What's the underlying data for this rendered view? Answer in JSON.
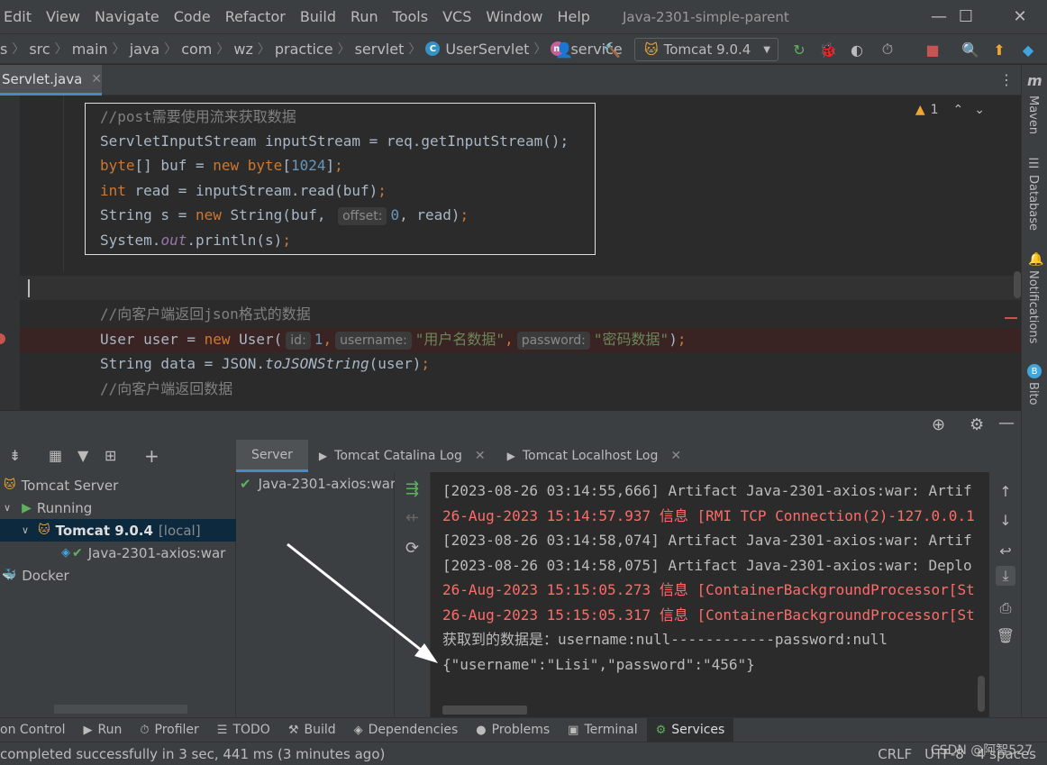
{
  "menu": {
    "items": [
      "Edit",
      "View",
      "Navigate",
      "Code",
      "Refactor",
      "Build",
      "Run",
      "Tools",
      "VCS",
      "Window",
      "Help"
    ],
    "project_title": "Java-2301-simple-parent"
  },
  "window_controls": {
    "minimize": "—",
    "maximize": "☐",
    "close": "✕"
  },
  "breadcrumb": {
    "items": [
      "s",
      "src",
      "main",
      "java",
      "com",
      "wz",
      "practice",
      "servlet",
      "UserServlet",
      "service"
    ]
  },
  "run_config": {
    "label": "Tomcat 9.0.4"
  },
  "editor_tab": {
    "label": "Servlet.java",
    "close": "✕"
  },
  "editor": {
    "warning_count": "1",
    "lines": {
      "l1_comment": "//post需要使用流来获取数据",
      "l2": {
        "a": "ServletInputStream inputStream = req.getInputStream();"
      },
      "l3": {
        "kw1": "byte",
        "t1": "[] buf = ",
        "kw2": "new",
        "t2": " ",
        "kw3": "byte",
        "t3": "[",
        "num": "1024",
        "t4": "]",
        "semi": ";"
      },
      "l4": {
        "kw": "int",
        "t": " read = inputStream.read(buf)",
        "semi": ";"
      },
      "l5": {
        "t1": "String s = ",
        "kw": "new",
        "t2": " String(buf, ",
        "hint": "offset:",
        "num": "0",
        "t3": ", read)",
        "semi": ";"
      },
      "l6": {
        "t1": "System.",
        "field": "out",
        "t2": ".println(s)",
        "semi": ";"
      },
      "l7_comment": "//向客户端返回json格式的数据",
      "l8": {
        "t1": "User user = ",
        "kw": "new",
        "t2": " User(",
        "hint1": "id:",
        "num": "1",
        "comma1": ",",
        "hint2": "username:",
        "str1": "\"用户名数据\"",
        "comma2": ",",
        "hint3": "password:",
        "str2": "\"密码数据\"",
        "t3": ")",
        "semi": ";"
      },
      "l9": {
        "t1": "String data = JSON.",
        "fn": "toJSONString",
        "t2": "(user)",
        "semi": ";"
      },
      "l10_comment": "//向客户端返回数据"
    }
  },
  "right_strip": {
    "maven": "Maven",
    "database": "Database",
    "notifications": "Notifications",
    "bito": "Bito"
  },
  "services": {
    "tree": {
      "tomcat_server": "Tomcat Server",
      "running": "Running",
      "tomcat_instance": "Tomcat 9.0.4",
      "tomcat_local": "[local]",
      "artifact": "Java-2301-axios:war",
      "docker": "Docker"
    },
    "tabs": {
      "server": "Server",
      "catalina": "Tomcat Catalina Log",
      "localhost": "Tomcat Localhost Log"
    },
    "deployment": "Java-2301-axios:war",
    "console": [
      {
        "text": "[2023-08-26 03:14:55,666] Artifact Java-2301-axios:war: Artif",
        "color": "white"
      },
      {
        "text": "26-Aug-2023 15:14:57.937 信息 [RMI TCP Connection(2)-127.0.0.1",
        "color": "red"
      },
      {
        "text": "[2023-08-26 03:14:58,074] Artifact Java-2301-axios:war: Artif",
        "color": "white"
      },
      {
        "text": "[2023-08-26 03:14:58,075] Artifact Java-2301-axios:war: Deplo",
        "color": "white"
      },
      {
        "text": "26-Aug-2023 15:15:05.273 信息 [ContainerBackgroundProcessor[St",
        "color": "red"
      },
      {
        "text": "26-Aug-2023 15:15:05.317 信息 [ContainerBackgroundProcessor[St",
        "color": "red"
      },
      {
        "text": "获取到的数据是：username:null------------password:null",
        "color": "white"
      },
      {
        "text": "{\"username\":\"Lisi\",\"password\":\"456\"}",
        "color": "white"
      }
    ]
  },
  "tool_windows": {
    "version_control": "on Control",
    "run": "Run",
    "profiler": "Profiler",
    "todo": "TODO",
    "build": "Build",
    "dependencies": "Dependencies",
    "problems": "Problems",
    "terminal": "Terminal",
    "services": "Services"
  },
  "status": {
    "message": "completed successfully in 3 sec, 441 ms (3 minutes ago)",
    "line_sep": "CRLF",
    "encoding": "UTF-8",
    "indent": "4 spaces",
    "watermark": "CSDN @阿智527"
  }
}
